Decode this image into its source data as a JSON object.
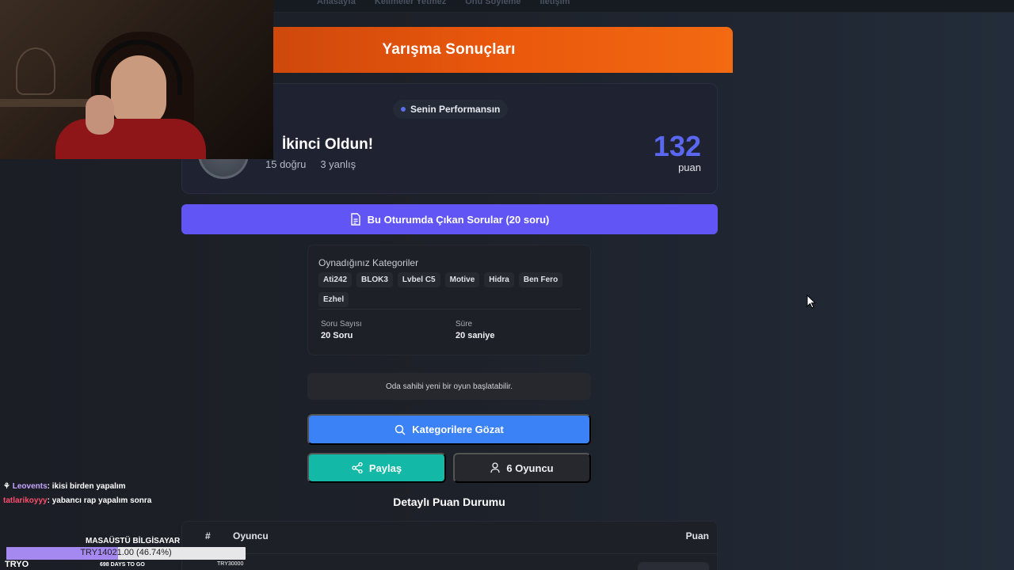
{
  "nav": {
    "links": [
      "Anasayfa",
      "Kelimeler Yetmez",
      "Onu Söyleme",
      "İletişim"
    ]
  },
  "banner": {
    "title": "Yarışma Sonuçları"
  },
  "performance": {
    "pill_label": "Senin Performansın",
    "place_title": "İkinci Oldun!",
    "correct": "15 doğru",
    "wrong": "3 yanlış",
    "score": "132",
    "score_unit": "puan"
  },
  "questions_button": {
    "label": "Bu Oturumda Çıkan Sorular (20 soru)"
  },
  "categories": {
    "title": "Oynadığınız Kategoriler",
    "tags": [
      "Ati242",
      "BLOK3",
      "Lvbel C5",
      "Motive",
      "Hidra",
      "Ben Fero",
      "Ezhel"
    ],
    "question_count_label": "Soru Sayısı",
    "question_count_value": "20 Soru",
    "time_label": "Süre",
    "time_value": "20 saniye"
  },
  "owner_note": "Oda sahibi yeni bir oyun başlatabilir.",
  "browse_button": {
    "label": "Kategorilere Gözat"
  },
  "share_button": {
    "label": "Paylaş"
  },
  "players_button": {
    "label": "6 Oyuncu"
  },
  "detail": {
    "title": "Detaylı Puan Durumu",
    "col_rank": "#",
    "col_player": "Oyuncu",
    "col_score": "Puan"
  },
  "chat": [
    {
      "user": "Leovents",
      "message": ": ikisi birden yapalım"
    },
    {
      "user": "tatlarikoyyy",
      "message": ": yabancı rap yapalım sonra"
    }
  ],
  "goal": {
    "title": "MASAÜSTÜ BİLGİSAYAR",
    "progress_text": "TRY14021.00 (46.74%)",
    "progress_fraction": 0.4674,
    "left_label": "TRYO",
    "days_label": "698 DAYS TO GO",
    "right_label": "TRY30000"
  },
  "colors": {
    "banner": "#ea580c",
    "questions_button": "#6155f5",
    "browse_button": "#3b82f6",
    "share_button": "#14b8a6",
    "score": "#5a67f0"
  }
}
